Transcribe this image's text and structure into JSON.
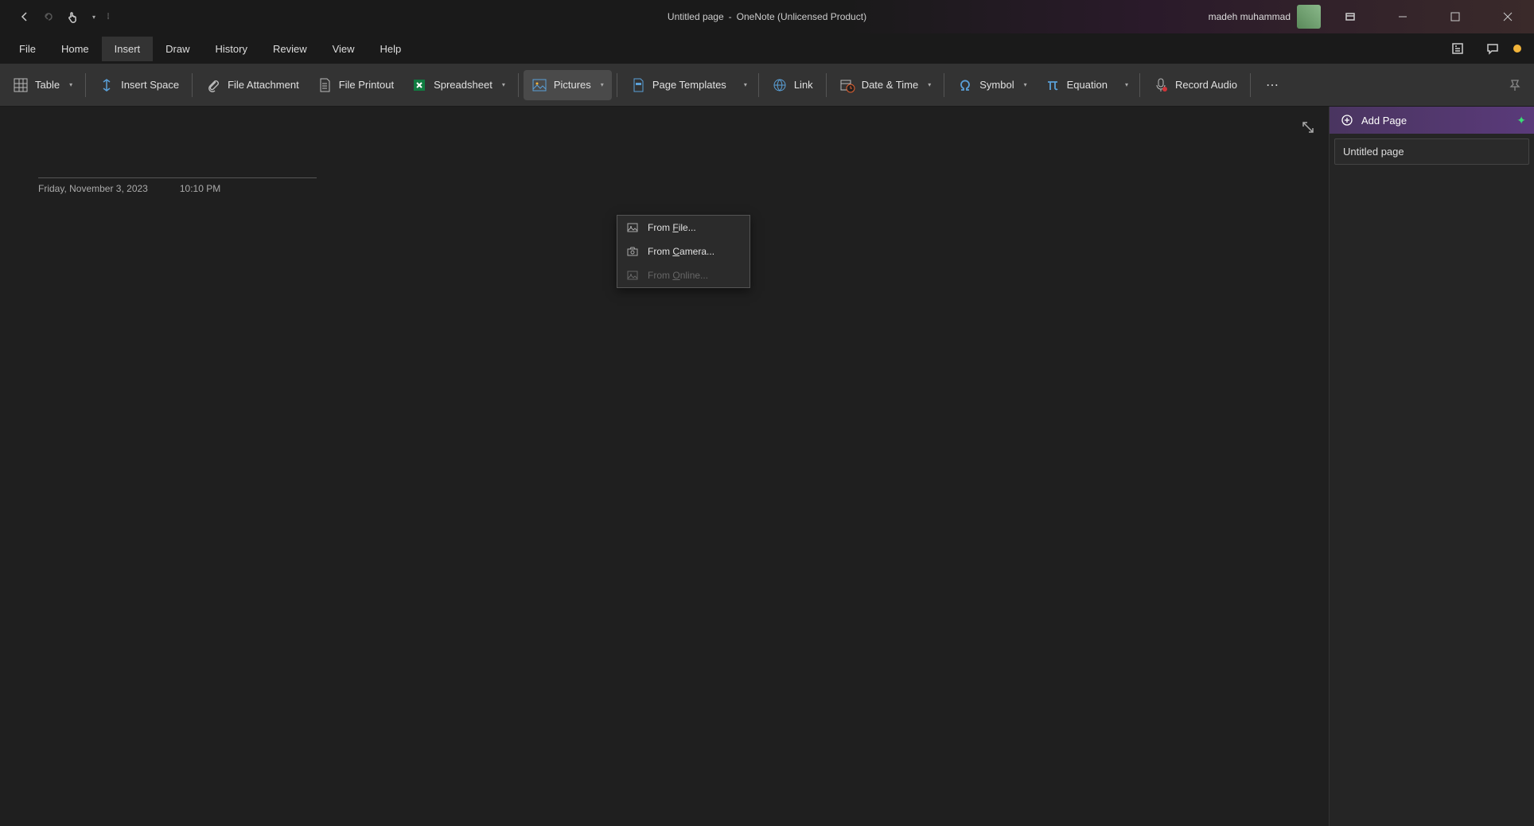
{
  "title_bar": {
    "doc_title": "Untitled page",
    "separator": "-",
    "app_name": "OneNote (Unlicensed Product)",
    "user_name": "madeh muhammad"
  },
  "menu": {
    "items": [
      "File",
      "Home",
      "Insert",
      "Draw",
      "History",
      "Review",
      "View",
      "Help"
    ],
    "active_index": 2
  },
  "ribbon": {
    "table": "Table",
    "insert_space": "Insert Space",
    "file_attachment": "File Attachment",
    "file_printout": "File Printout",
    "spreadsheet": "Spreadsheet",
    "pictures": "Pictures",
    "page_templates": "Page Templates",
    "link": "Link",
    "date_time": "Date & Time",
    "symbol": "Symbol",
    "equation": "Equation",
    "record_audio": "Record Audio"
  },
  "pictures_menu": {
    "from_file_prefix": "From ",
    "from_file_u": "F",
    "from_file_suffix": "ile...",
    "from_camera_prefix": "From ",
    "from_camera_u": "C",
    "from_camera_suffix": "amera...",
    "from_online_prefix": "From ",
    "from_online_u": "O",
    "from_online_suffix": "nline..."
  },
  "canvas": {
    "date": "Friday, November 3, 2023",
    "time": "10:10 PM"
  },
  "side_panel": {
    "add_page": "Add Page",
    "pages": [
      "Untitled page"
    ]
  }
}
